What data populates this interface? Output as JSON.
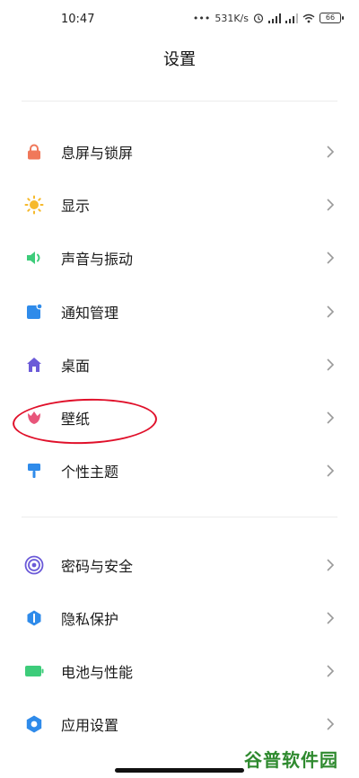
{
  "status": {
    "time": "10:47",
    "speed": "531K/s",
    "battery": "66"
  },
  "header": {
    "title": "设置"
  },
  "groups": [
    {
      "items": [
        {
          "label": "息屏与锁屏",
          "icon": "lock-icon",
          "color": "#f0785a"
        },
        {
          "label": "显示",
          "icon": "sun-icon",
          "color": "#f6b92b"
        },
        {
          "label": "声音与振动",
          "icon": "speaker-icon",
          "color": "#3dcc7a"
        },
        {
          "label": "通知管理",
          "icon": "notification-icon",
          "color": "#2f8bea"
        },
        {
          "label": "桌面",
          "icon": "home-icon",
          "color": "#6b5ad8"
        },
        {
          "label": "壁纸",
          "icon": "tulip-icon",
          "color": "#e8557a"
        },
        {
          "label": "个性主题",
          "icon": "brush-icon",
          "color": "#2f8bea"
        }
      ]
    },
    {
      "items": [
        {
          "label": "密码与安全",
          "icon": "fingerprint-icon",
          "color": "#6b5ad8"
        },
        {
          "label": "隐私保护",
          "icon": "privacy-icon",
          "color": "#2f8bea"
        },
        {
          "label": "电池与性能",
          "icon": "battery-icon",
          "color": "#3dcc7a"
        },
        {
          "label": "应用设置",
          "icon": "gear-icon",
          "color": "#2f8bea"
        }
      ]
    }
  ],
  "watermark": "谷普软件园",
  "annotation_color": "#e0102a"
}
